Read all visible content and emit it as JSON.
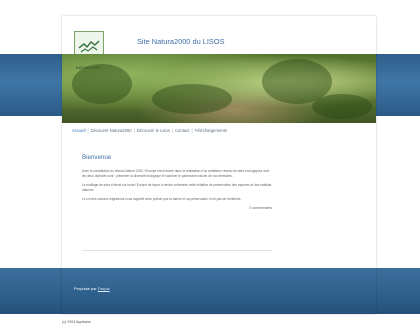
{
  "header": {
    "site_title": "Site Natura2000 du LISOS",
    "logo_text": "NATURA 2000"
  },
  "nav": {
    "items": [
      {
        "label": "Accueil"
      },
      {
        "label": "Découvrir Natura2000"
      },
      {
        "label": "Découvrir le Lisos"
      },
      {
        "label": "Contact"
      },
      {
        "label": "Téléchargements"
      }
    ]
  },
  "post": {
    "title": "Bienvenue",
    "paragraphs": [
      "Avec la constitution du réseau Natura 2000, l'Europe s'est lancée dans la réalisation d'un ambitieux réseau de sites écologiques dont les deux objectifs sont : préserver la diversité biologique et valoriser le patrimoine naturel de nos territoires.",
      "Le maillage de sites s'étend sur toute l'Europe de façon à rendre cohérente cette initiative de préservation des espèces et des habitats naturels.",
      "Le vol des oiseaux migrateurs nous rappelle avec poésie que la nature et sa préservation n'ont pas de frontières."
    ],
    "comments": "0 commentaires"
  },
  "footer": {
    "powered_prefix": "Propulsé par",
    "powered_link": "Drupal"
  },
  "copyright": "(c) 2004 Aquitaine",
  "colors": {
    "accent": "#3e6fa8",
    "band": "#2e5f8c"
  }
}
